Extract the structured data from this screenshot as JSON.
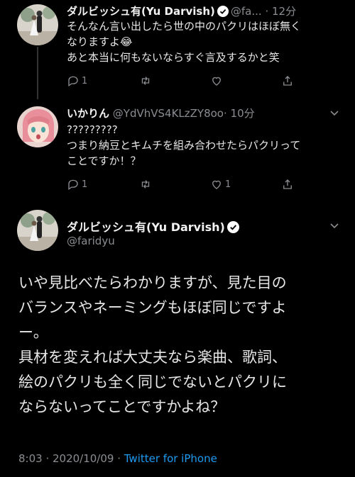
{
  "tweets": [
    {
      "name": "ダルビッシュ有(Yu Darvish)",
      "handle": "@fa...",
      "time": "· 12分",
      "lines": [
        "そんなん言い出したら世の中のパクリはほぼ無く",
        "なりますよ😂",
        "あと本当に何もないならすぐ言及するかと笑"
      ],
      "reply_count": "1",
      "retweet_count": "",
      "like_count": ""
    },
    {
      "name": "いかりん",
      "handle": "@YdVhVS4KLzZY8oo",
      "time": "· 10分",
      "lines": [
        "?????????",
        "つまり納豆とキムチを組み合わせたらパクリって",
        "ことですか！？"
      ],
      "reply_count": "1",
      "retweet_count": "",
      "like_count": "1"
    }
  ],
  "main": {
    "name": "ダルビッシュ有(Yu Darvish)",
    "handle": "@faridyu",
    "lines": [
      "いや見比べたらわかりますが、見た目の",
      "バランスやネーミングもほぼ同じですよ",
      "ー。",
      "具材を変えれば大丈夫なら楽曲、歌詞、",
      "絵のパクリも全く同じでないとパクリに",
      "ならないってことですかよね？"
    ],
    "timestamp": "8:03 · 2020/10/09 · ",
    "source": "Twitter for iPhone"
  },
  "colors": {
    "background": "#000000",
    "link": "#1d9bf0",
    "secondary_text": "#8a8d91",
    "verified": "#ffffff"
  }
}
